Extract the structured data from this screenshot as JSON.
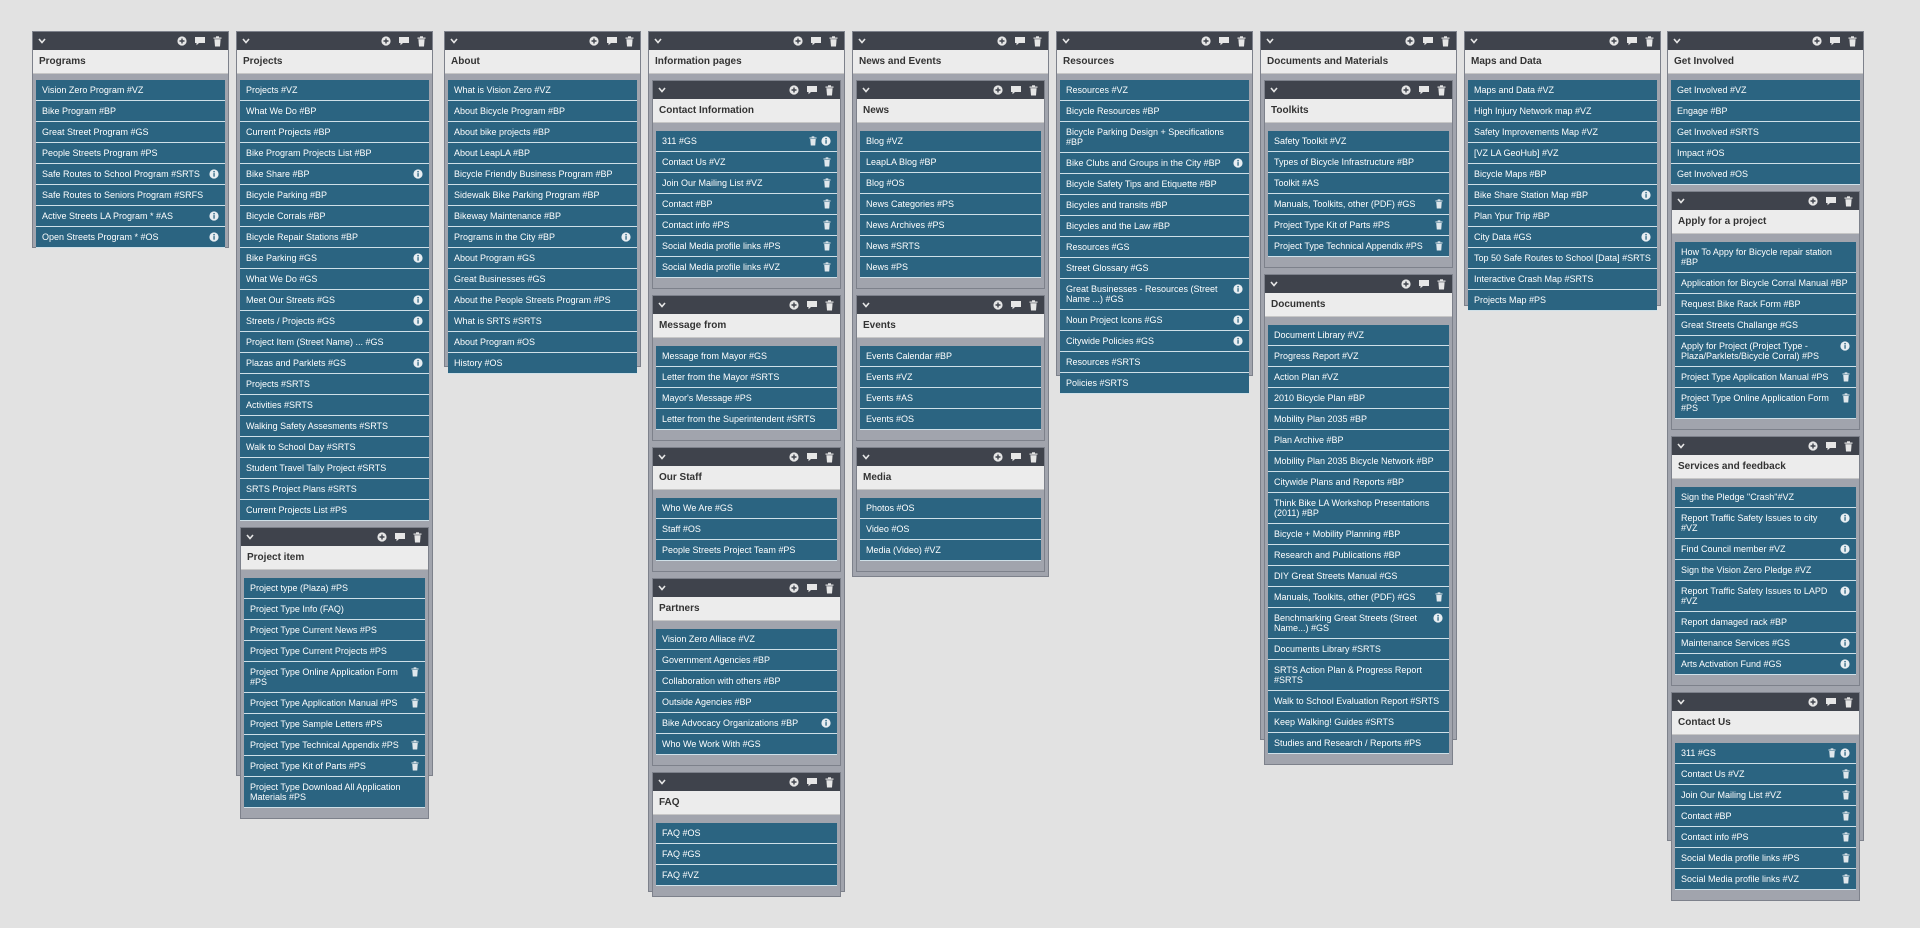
{
  "colors": {
    "background": "#e2e2e2",
    "header": "#3f434c",
    "item": "#2b6481",
    "panel": "#a1a4ad",
    "title": "#ececec"
  },
  "icons": {
    "collapse": "chevron-down-icon",
    "add": "plus-icon",
    "comment": "comment-icon",
    "delete": "trash-icon",
    "info": "info-icon"
  },
  "columns": [
    {
      "title": "Programs",
      "items": [
        {
          "label": "Vision Zero Program #VZ"
        },
        {
          "label": "Bike Program #BP"
        },
        {
          "label": "Great Street Program #GS"
        },
        {
          "label": "People Streets Program #PS"
        },
        {
          "label": "Safe Routes to School Program #SRTS",
          "info": true
        },
        {
          "label": "Safe Routes to Seniors Program #SRFS"
        },
        {
          "label": "Active Streets LA Program * #AS",
          "info": true
        },
        {
          "label": "Open Streets Program * #OS",
          "info": true
        }
      ],
      "groups": []
    },
    {
      "title": "Projects",
      "items": [
        {
          "label": "Projects #VZ"
        },
        {
          "label": "What We Do #BP"
        },
        {
          "label": "Current Projects #BP"
        },
        {
          "label": "Bike Program Projects List #BP"
        },
        {
          "label": "Bike Share #BP",
          "info": true
        },
        {
          "label": "Bicycle Parking #BP"
        },
        {
          "label": "Bicycle Corrals #BP"
        },
        {
          "label": "Bicycle Repair Stations #BP"
        },
        {
          "label": "Bike Parking #GS",
          "info": true
        },
        {
          "label": "What We Do #GS"
        },
        {
          "label": "Meet Our Streets #GS",
          "info": true
        },
        {
          "label": "Streets / Projects #GS",
          "info": true
        },
        {
          "label": "Project Item (Street Name) ... #GS"
        },
        {
          "label": "Plazas and Parklets #GS",
          "info": true
        },
        {
          "label": "Projects #SRTS"
        },
        {
          "label": "Activities #SRTS"
        },
        {
          "label": "Walking Safety Assesments #SRTS"
        },
        {
          "label": "Walk to School Day #SRTS"
        },
        {
          "label": "Student Travel Tally Project #SRTS"
        },
        {
          "label": "SRTS Project Plans #SRTS"
        },
        {
          "label": "Current Projects List #PS"
        }
      ],
      "groups": [
        {
          "title": "Project item",
          "items": [
            {
              "label": "Project type (Plaza) #PS"
            },
            {
              "label": "Project Type Info (FAQ)"
            },
            {
              "label": "Project Type Current News #PS"
            },
            {
              "label": "Project Type Current Projects #PS"
            },
            {
              "label": "Project Type Online Application Form #PS",
              "trash": true
            },
            {
              "label": "Project Type Application Manual #PS",
              "trash": true
            },
            {
              "label": "Project Type Sample Letters #PS"
            },
            {
              "label": "Project Type Technical Appendix #PS",
              "trash": true
            },
            {
              "label": "Project Type Kit of Parts #PS",
              "trash": true
            },
            {
              "label": "Project Type Download All Application Materials #PS"
            }
          ]
        }
      ]
    },
    {
      "title": "About",
      "items": [
        {
          "label": "What is Vision Zero #VZ"
        },
        {
          "label": "About Bicycle Program #BP"
        },
        {
          "label": "About bike projects #BP"
        },
        {
          "label": "About LeapLA #BP"
        },
        {
          "label": "Bicycle Friendly Business Program #BP"
        },
        {
          "label": "Sidewalk Bike Parking Program #BP"
        },
        {
          "label": "Bikeway Maintenance #BP"
        },
        {
          "label": "Programs in the City #BP",
          "info": true
        },
        {
          "label": "About Program #GS"
        },
        {
          "label": "Great Businesses #GS"
        },
        {
          "label": "About the People Streets Program #PS"
        },
        {
          "label": "What is SRTS #SRTS"
        },
        {
          "label": "About Program #OS"
        },
        {
          "label": "History #OS"
        }
      ],
      "groups": []
    },
    {
      "title": "Information pages",
      "items": [],
      "groups": [
        {
          "title": "Contact Information",
          "items": [
            {
              "label": "311 #GS",
              "trash": true,
              "info": true
            },
            {
              "label": "Contact Us #VZ",
              "trash": true
            },
            {
              "label": "Join Our Mailing List #VZ",
              "trash": true
            },
            {
              "label": "Contact #BP",
              "trash": true
            },
            {
              "label": "Contact info #PS",
              "trash": true
            },
            {
              "label": "Social Media profile links #PS",
              "trash": true
            },
            {
              "label": "Social Media profile links #VZ",
              "trash": true
            }
          ]
        },
        {
          "title": "Message from",
          "items": [
            {
              "label": "Message from Mayor #GS"
            },
            {
              "label": "Letter from the Mayor #SRTS"
            },
            {
              "label": "Mayor's Message #PS"
            },
            {
              "label": "Letter from the Superintendent #SRTS"
            }
          ]
        },
        {
          "title": "Our Staff",
          "items": [
            {
              "label": "Who We Are #GS"
            },
            {
              "label": "Staff #OS"
            },
            {
              "label": "People Streets Project Team #PS"
            }
          ]
        },
        {
          "title": "Partners",
          "items": [
            {
              "label": "Vision Zero Alliace #VZ"
            },
            {
              "label": "Government Agencies #BP"
            },
            {
              "label": "Collaboration with others #BP"
            },
            {
              "label": "Outside Agencies #BP"
            },
            {
              "label": "Bike Advocacy Organizations #BP",
              "info": true
            },
            {
              "label": "Who We Work With #GS"
            }
          ]
        },
        {
          "title": "FAQ",
          "items": [
            {
              "label": "FAQ #OS"
            },
            {
              "label": "FAQ #GS"
            },
            {
              "label": "FAQ #VZ"
            }
          ]
        }
      ]
    },
    {
      "title": "News and Events",
      "items": [],
      "groups": [
        {
          "title": "News",
          "items": [
            {
              "label": "Blog #VZ"
            },
            {
              "label": "LeapLA Blog #BP"
            },
            {
              "label": "Blog #OS"
            },
            {
              "label": "News Categories #PS"
            },
            {
              "label": "News Archives #PS"
            },
            {
              "label": "News #SRTS"
            },
            {
              "label": "News #PS"
            }
          ]
        },
        {
          "title": "Events",
          "items": [
            {
              "label": "Events Calendar #BP"
            },
            {
              "label": "Events #VZ"
            },
            {
              "label": "Events #AS"
            },
            {
              "label": "Events #OS"
            }
          ]
        },
        {
          "title": "Media",
          "items": [
            {
              "label": "Photos #OS"
            },
            {
              "label": "Video #OS"
            },
            {
              "label": "Media (Video) #VZ"
            }
          ]
        }
      ]
    },
    {
      "title": "Resources",
      "items": [
        {
          "label": "Resources #VZ"
        },
        {
          "label": "Bicycle Resources #BP"
        },
        {
          "label": "Bicycle Parking Design + Specifications #BP"
        },
        {
          "label": "Bike Clubs and Groups in the City #BP",
          "info": true
        },
        {
          "label": "Bicycle Safety Tips and Etiquette #BP"
        },
        {
          "label": "Bicycles and transits #BP"
        },
        {
          "label": "Bicycles and the Law #BP"
        },
        {
          "label": "Resources #GS"
        },
        {
          "label": "Street Glossary #GS"
        },
        {
          "label": "Great Businesses - Resources (Street Name ...) #GS",
          "info": true
        },
        {
          "label": "Noun Project Icons #GS",
          "info": true
        },
        {
          "label": "Citywide Policies #GS",
          "info": true
        },
        {
          "label": "Resources #SRTS"
        },
        {
          "label": "Policies #SRTS"
        }
      ],
      "groups": []
    },
    {
      "title": "Documents and Materials",
      "items": [],
      "groups": [
        {
          "title": "Toolkits",
          "items": [
            {
              "label": "Safety Toolkit #VZ"
            },
            {
              "label": "Types of Bicycle Infrastructure #BP"
            },
            {
              "label": "Toolkit #AS"
            },
            {
              "label": "Manuals, Toolkits, other (PDF) #GS",
              "trash": true
            },
            {
              "label": "Project Type Kit of Parts #PS",
              "trash": true
            },
            {
              "label": "Project Type Technical Appendix #PS",
              "trash": true
            }
          ]
        },
        {
          "title": "Documents",
          "items": [
            {
              "label": "Document Library #VZ"
            },
            {
              "label": "Progress Report #VZ"
            },
            {
              "label": "Action Plan #VZ"
            },
            {
              "label": "2010 Bicycle Plan #BP"
            },
            {
              "label": "Mobility Plan 2035 #BP"
            },
            {
              "label": "Plan Archive #BP"
            },
            {
              "label": "Mobility Plan 2035 Bicycle Network #BP"
            },
            {
              "label": "Citywide Plans and Reports #BP"
            },
            {
              "label": "Think Bike LA Workshop Presentations (2011) #BP"
            },
            {
              "label": "Bicycle + Mobility Planning #BP"
            },
            {
              "label": "Research and Publications #BP"
            },
            {
              "label": "DIY Great Streets Manual #GS"
            },
            {
              "label": "Manuals, Toolkits, other (PDF) #GS",
              "trash": true
            },
            {
              "label": "Benchmarking Great Streets (Street Name...) #GS",
              "info": true
            },
            {
              "label": "Documents Library #SRTS"
            },
            {
              "label": "SRTS Action Plan & Progress Report #SRTS"
            },
            {
              "label": "Walk to School Evaluation Report #SRTS"
            },
            {
              "label": "Keep Walking! Guides #SRTS"
            },
            {
              "label": "Studies and Research / Reports #PS"
            }
          ]
        }
      ]
    },
    {
      "title": "Maps and Data",
      "items": [
        {
          "label": "Maps and Data #VZ"
        },
        {
          "label": "High Injury Network map #VZ"
        },
        {
          "label": "Safety Improvements Map #VZ"
        },
        {
          "label": "[VZ LA GeoHub] #VZ"
        },
        {
          "label": "Bicycle Maps #BP"
        },
        {
          "label": "Bike Share Station Map #BP",
          "info": true
        },
        {
          "label": "Plan Ypur Trip #BP"
        },
        {
          "label": "City Data #GS",
          "info": true
        },
        {
          "label": "Top 50 Safe Routes to School [Data] #SRTS"
        },
        {
          "label": "Interactive Crash Map #SRTS"
        },
        {
          "label": "Projects Map #PS"
        }
      ],
      "groups": []
    },
    {
      "title": "Get Involved",
      "items": [
        {
          "label": "Get Involved #VZ"
        },
        {
          "label": "Engage #BP"
        },
        {
          "label": "Get Involved #SRTS"
        },
        {
          "label": "Impact #OS"
        },
        {
          "label": "Get Involved #OS"
        }
      ],
      "groups": [
        {
          "title": "Apply for a project",
          "items": [
            {
              "label": "How To Appy for Bicycle repair station #BP"
            },
            {
              "label": "Application for Bicycle Corral Manual #BP"
            },
            {
              "label": "Request Bike Rack Form #BP"
            },
            {
              "label": "Great Streets Challange #GS"
            },
            {
              "label": "Apply for Project (Project Type - Plaza/Parklets/Bicycle Corral) #PS",
              "info": true
            },
            {
              "label": "Project Type Application Manual #PS",
              "trash": true
            },
            {
              "label": "Project Type Online Application Form #PS",
              "trash": true
            }
          ]
        },
        {
          "title": "Services and feedback",
          "items": [
            {
              "label": "Sign the Pledge \"Crash\"#VZ"
            },
            {
              "label": "Report Traffic Safety Issues to city #VZ",
              "info": true
            },
            {
              "label": "Find Council member #VZ",
              "info": true
            },
            {
              "label": "Sign the Vision Zero Pledge #VZ"
            },
            {
              "label": "Report Traffic Safety Issues to LAPD #VZ",
              "info": true
            },
            {
              "label": "Report damaged rack #BP"
            },
            {
              "label": "Maintenance Services #GS",
              "info": true
            },
            {
              "label": "Arts Activation Fund #GS",
              "info": true
            }
          ]
        },
        {
          "title": "Contact Us",
          "items": [
            {
              "label": "311 #GS",
              "trash": true,
              "info": true
            },
            {
              "label": "Contact Us #VZ",
              "trash": true
            },
            {
              "label": "Join Our Mailing List #VZ",
              "trash": true
            },
            {
              "label": "Contact #BP",
              "trash": true
            },
            {
              "label": "Contact info #PS",
              "trash": true
            },
            {
              "label": "Social Media profile links #PS",
              "trash": true
            },
            {
              "label": "Social Media profile links #VZ",
              "trash": true
            }
          ]
        }
      ]
    }
  ]
}
